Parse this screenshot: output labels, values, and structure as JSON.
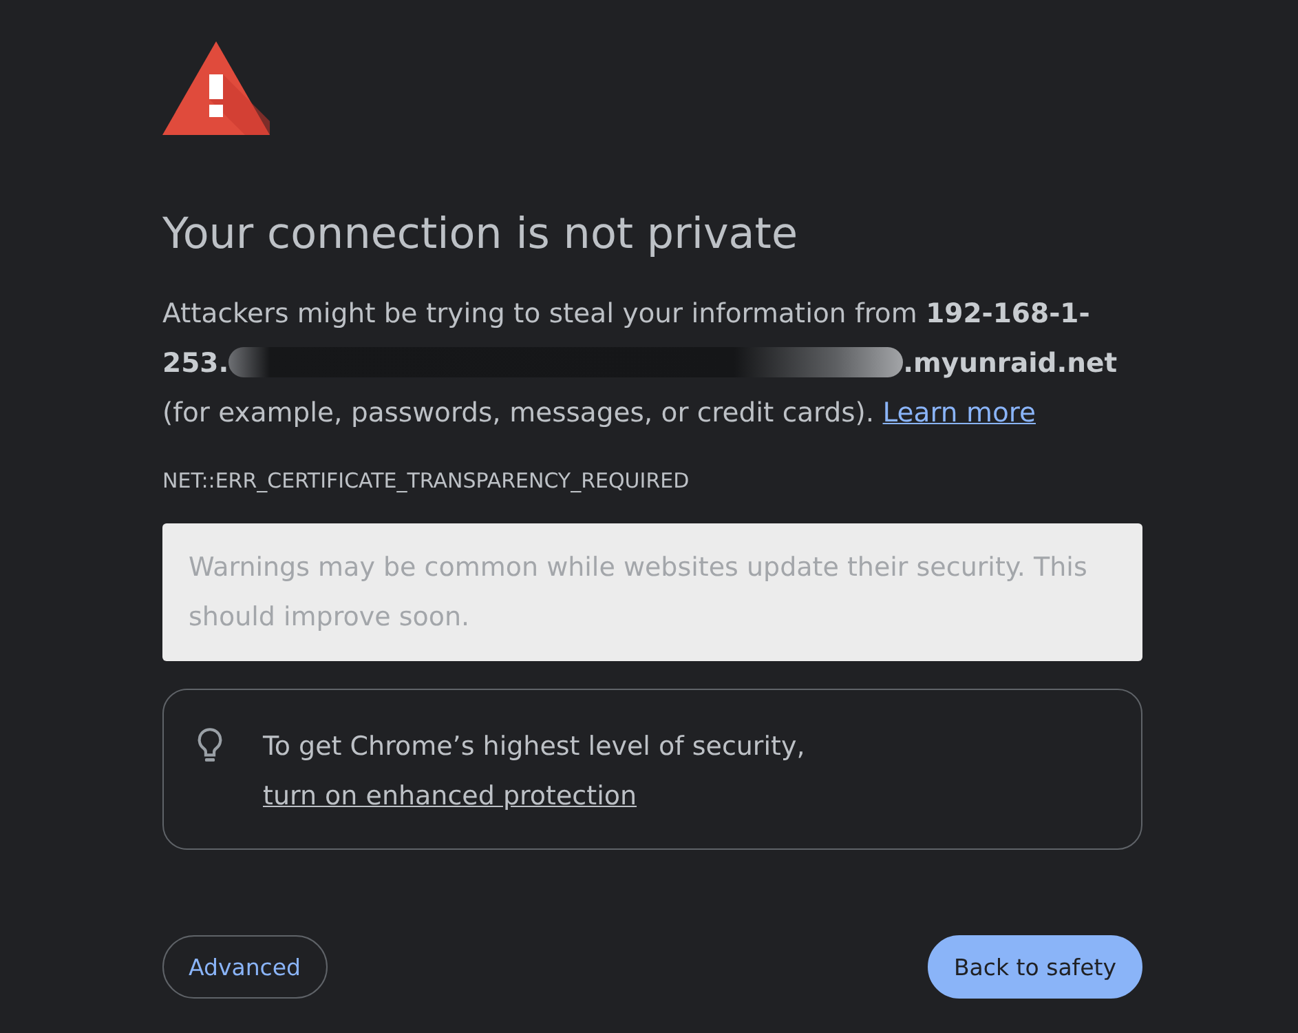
{
  "heading": "Your connection is not private",
  "message": {
    "text_before": "Attackers might be trying to steal your information from ",
    "host_start": "192-168-1-253.",
    "host_redacted": true,
    "host_end": ".myunraid.net",
    "text_after": " (for example, passwords, messages, or credit cards). ",
    "link": "Learn more"
  },
  "error_code": "NET::ERR_CERTIFICATE_TRANSPARENCY_REQUIRED",
  "notice": "Warnings may be common while websites update their security. This should improve soon.",
  "protection_tip": {
    "text": "To get Chrome’s highest level of security, ",
    "link": "turn on enhanced protection"
  },
  "buttons": [
    {
      "label": "Advanced",
      "kind": "secondary"
    },
    {
      "label": "Back to safety",
      "kind": "primary"
    }
  ]
}
